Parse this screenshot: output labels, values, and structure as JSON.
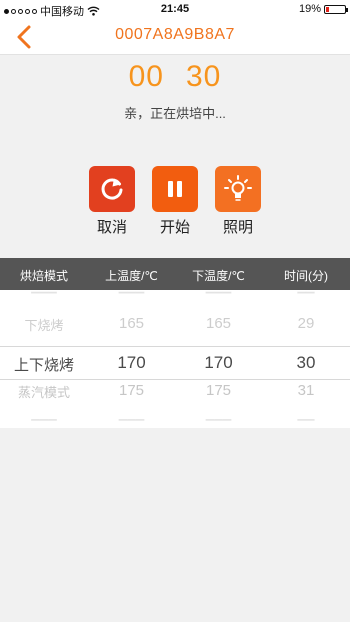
{
  "status_bar": {
    "carrier": "中国移动",
    "time": "21:45",
    "battery": "19%",
    "battery_level": 0.19,
    "signal_bars_filled": 1,
    "wifi_icon": "wifi-icon"
  },
  "nav": {
    "back_icon": "chevron-left-icon",
    "title": "0007A8A9B8A7"
  },
  "timer": {
    "minutes": "00",
    "seconds": "30",
    "status": "亲，正在烘培中..."
  },
  "controls": [
    {
      "label": "取消",
      "icon": "refresh-icon",
      "color": "#e2401f"
    },
    {
      "label": "开始",
      "icon": "pause-icon",
      "color": "#f25d0f"
    },
    {
      "label": "照明",
      "icon": "light-bulb-icon",
      "color": "#f37022"
    }
  ],
  "table": {
    "headers": [
      "烘焙模式",
      "上温度/℃",
      "下温度/℃",
      "时间(分)"
    ],
    "rows": [
      {
        "mode": "下烧烤",
        "top": "165",
        "bottom": "165",
        "time": "29"
      },
      {
        "mode": "上下烧烤",
        "top": "170",
        "bottom": "170",
        "time": "30"
      },
      {
        "mode": "蒸汽模式",
        "top": "175",
        "bottom": "175",
        "time": "31"
      }
    ]
  },
  "colors": {
    "accent": "#f0741e",
    "timer": "#f7941d",
    "header_bg": "#555555"
  }
}
